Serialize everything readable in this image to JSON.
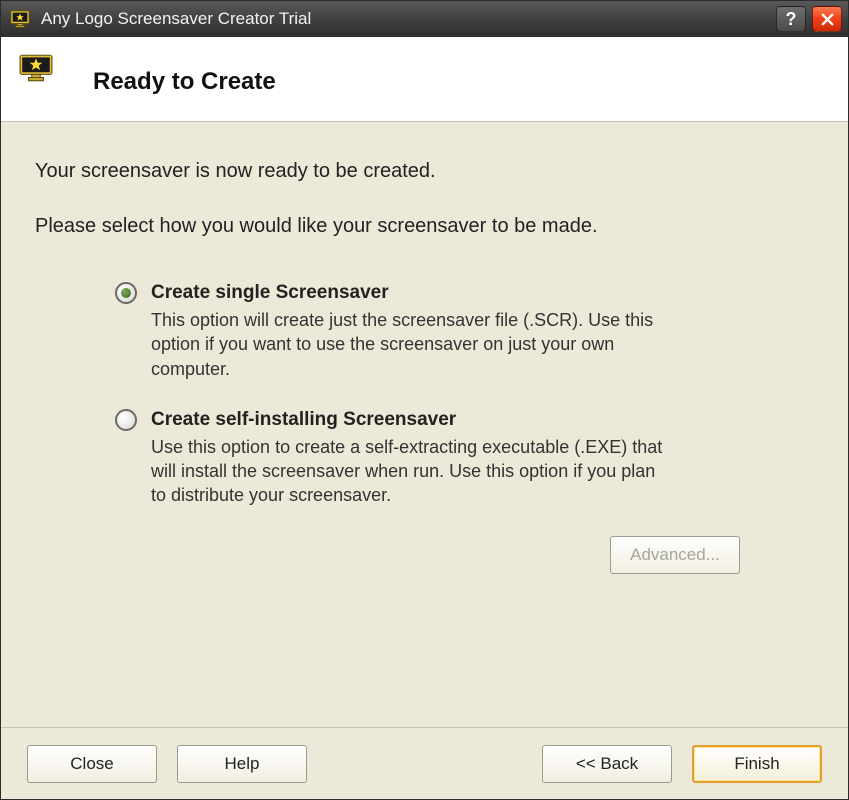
{
  "titlebar": {
    "title": "Any Logo Screensaver Creator Trial"
  },
  "header": {
    "heading": "Ready to Create"
  },
  "content": {
    "intro": "Your screensaver is now ready to be created.",
    "instruction": "Please select how you would like your screensaver to be made.",
    "options": [
      {
        "title": "Create single Screensaver",
        "desc": "This option will create just the screensaver file (.SCR). Use this option if you want to use the screensaver on just your own computer.",
        "selected": true
      },
      {
        "title": "Create self-installing Screensaver",
        "desc": "Use this option to create a self-extracting executable (.EXE) that will install the screensaver when run. Use this option if you plan to distribute your screensaver.",
        "selected": false
      }
    ],
    "advanced_label": "Advanced..."
  },
  "footer": {
    "close": "Close",
    "help": "Help",
    "back": "<< Back",
    "finish": "Finish"
  }
}
